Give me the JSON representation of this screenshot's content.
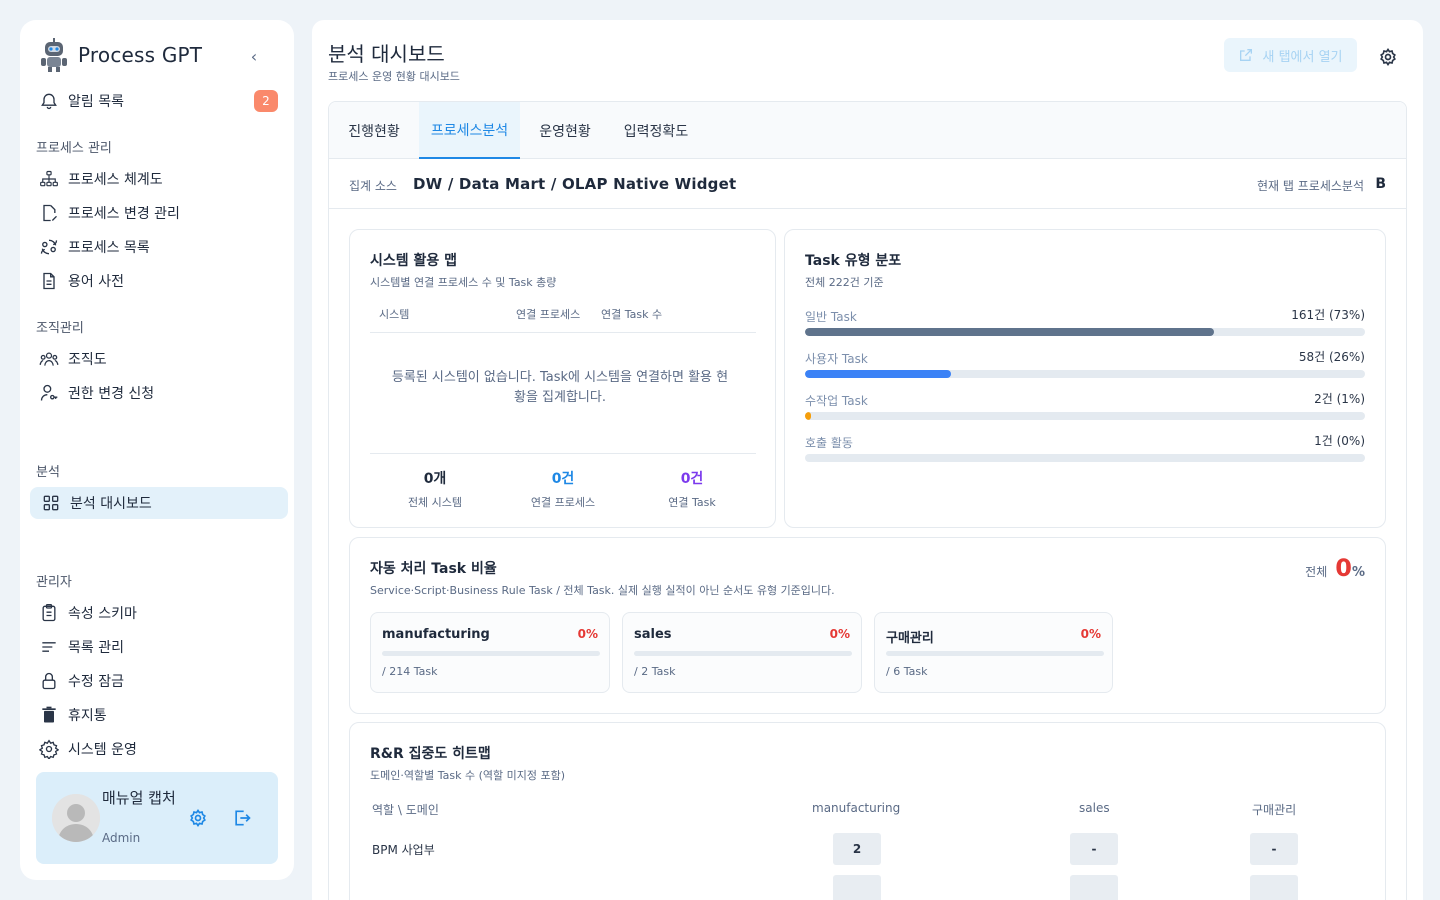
{
  "app": {
    "name": "Process GPT"
  },
  "sidebar": {
    "notifications": {
      "label": "알림 목록",
      "count": "2"
    },
    "sections": {
      "process": "프로세스 관리",
      "org": "조직관리",
      "analytics": "분석",
      "admin": "관리자"
    },
    "items": {
      "process_map": "프로세스 체계도",
      "process_change": "프로세스 변경 관리",
      "process_list": "프로세스 목록",
      "glossary": "용어 사전",
      "org_chart": "조직도",
      "permission_request": "권한 변경 신청",
      "analytics_dashboard": "분석 대시보드",
      "attribute_schema": "속성 스키마",
      "list_management": "목록 관리",
      "edit_lock": "수정 잠금",
      "trash": "휴지통",
      "system_ops": "시스템 운영"
    },
    "profile": {
      "name": "매뉴얼 캡처",
      "role": "Admin"
    }
  },
  "header": {
    "title": "분석 대시보드",
    "subtitle": "프로세스 운영 현황 대시보드",
    "open_new_tab": "새 탭에서 열기"
  },
  "tabs": [
    "진행현황",
    "프로세스분석",
    "운영현황",
    "입력정확도"
  ],
  "source_bar": {
    "label": "집계 소스",
    "value": "DW / Data Mart / OLAP Native Widget",
    "current_label": "현재 탭 프로세스분석",
    "current_value": "B"
  },
  "system_map": {
    "title": "시스템 활용 맵",
    "subtitle": "시스템별 연결 프로세스 수 및 Task 총량",
    "columns": [
      "시스템",
      "연결 프로세스",
      "연결 Task 수"
    ],
    "empty_message": "등록된 시스템이 없습니다. Task에 시스템을 연결하면 활용 현황을 집계합니다.",
    "stats": [
      {
        "value": "0개",
        "label": "전체 시스템",
        "color": "#1f2a3c"
      },
      {
        "value": "0건",
        "label": "연결 프로세스",
        "color": "#1e88e5"
      },
      {
        "value": "0건",
        "label": "연결 Task",
        "color": "#7c3aed"
      }
    ]
  },
  "task_distribution": {
    "title": "Task 유형 분포",
    "subtitle": "전체 222건 기준",
    "rows": [
      {
        "label": "일반 Task",
        "value": "161건 (73%)",
        "pct": 73,
        "color": "#5f738c"
      },
      {
        "label": "사용자 Task",
        "value": "58건 (26%)",
        "pct": 26,
        "color": "#3b82f6"
      },
      {
        "label": "수작업 Task",
        "value": "2건 (1%)",
        "pct": 1,
        "color": "#f59e0b"
      },
      {
        "label": "호출 활동",
        "value": "1건 (0%)",
        "pct": 0,
        "color": "#9ca3af"
      }
    ]
  },
  "auto_ratio": {
    "title": "자동 처리 Task 비율",
    "subtitle": "Service·Script·Business Rule Task / 전체 Task. 실제 실행 실적이 아닌 순서도 유형 기준입니다.",
    "total_label": "전체",
    "total_value": "0",
    "total_unit": "%",
    "domains": [
      {
        "name": "manufacturing",
        "pct": "0%",
        "tasks": "/ 214 Task"
      },
      {
        "name": "sales",
        "pct": "0%",
        "tasks": "/ 2 Task"
      },
      {
        "name": "구매관리",
        "pct": "0%",
        "tasks": "/ 6 Task"
      }
    ]
  },
  "heatmap": {
    "title": "R&R 집중도 히트맵",
    "subtitle": "도메인·역할별 Task 수 (역할 미지정 포함)",
    "corner": "역할 \\ 도메인",
    "columns": [
      "manufacturing",
      "sales",
      "구매관리"
    ],
    "rows": [
      {
        "role": "BPM 사업부",
        "values": [
          "2",
          "-",
          "-"
        ]
      }
    ]
  }
}
